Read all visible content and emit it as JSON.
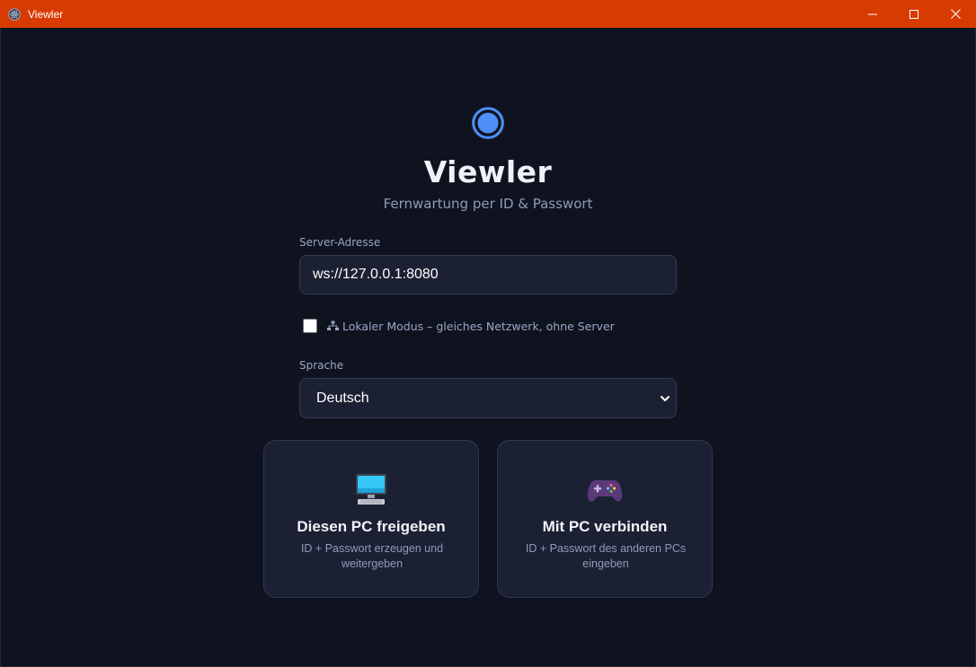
{
  "window": {
    "title": "Viewler",
    "accent_color": "#d83b01",
    "controls": [
      "minimize-icon",
      "maximize-icon",
      "close-icon"
    ]
  },
  "header": {
    "logo_icon": "radio-circle-icon",
    "logo_color": "#4f8ff7",
    "title": "Viewler",
    "subtitle": "Fernwartung per ID & Passwort"
  },
  "server": {
    "label": "Server-Adresse",
    "value": "ws://127.0.0.1:8080"
  },
  "local_mode": {
    "checked": false,
    "icon": "network-icon",
    "label": "Lokaler Modus – gleiches Netzwerk, ohne Server"
  },
  "language": {
    "label": "Sprache",
    "selected": "Deutsch"
  },
  "cards": [
    {
      "icon": "desktop-computer-icon",
      "title": "Diesen PC freigeben",
      "description": "ID + Passwort erzeugen und weitergeben"
    },
    {
      "icon": "game-controller-icon",
      "title": "Mit PC verbinden",
      "description": "ID + Passwort des anderen PCs eingeben"
    }
  ],
  "colors": {
    "background": "#0f1320",
    "surface": "#1b2133",
    "border": "#303a52",
    "muted_text": "#8f9bb8",
    "primary": "#4f8ff7"
  }
}
